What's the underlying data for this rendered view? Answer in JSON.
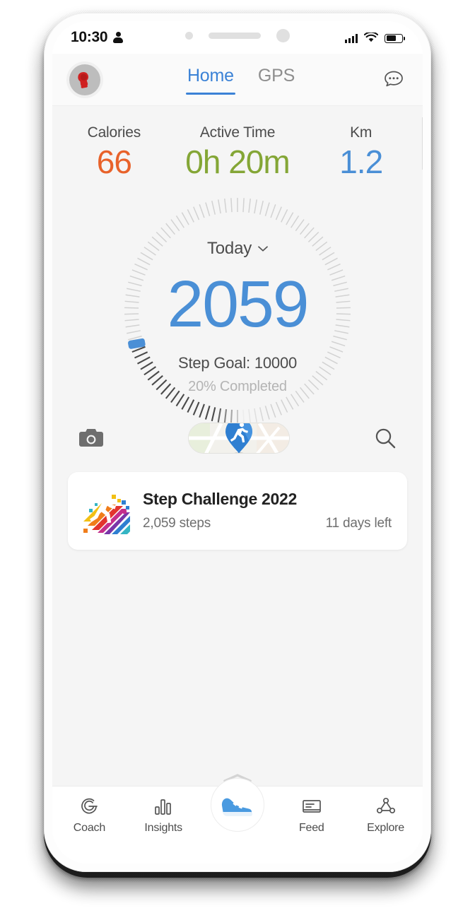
{
  "status_bar": {
    "time": "10:30",
    "person_icon": "person-icon",
    "signal_icon": "signal-bars-icon",
    "wifi_icon": "wifi-icon",
    "battery_icon": "battery-icon"
  },
  "header": {
    "avatar_icon": "avatar-boxing-glove",
    "tabs": [
      {
        "label": "Home",
        "active": true
      },
      {
        "label": "GPS",
        "active": false
      }
    ],
    "chat_icon": "chat-bubble-icon"
  },
  "stats": [
    {
      "label": "Calories",
      "value": "66",
      "color": "#e8622a"
    },
    {
      "label": "Active Time",
      "value": "0h 20m",
      "color": "#84a636"
    },
    {
      "label": "Km",
      "value": "1.2",
      "color": "#4a8fd6"
    }
  ],
  "dial": {
    "period_label": "Today",
    "chevron_icon": "chevron-down-icon",
    "steps": "2059",
    "step_goal_label": "Step Goal: 10000",
    "completed_label": "20% Completed",
    "progress_percent": 20,
    "accent_color": "#4a8fd6",
    "tick_total": 110
  },
  "actions": {
    "camera_icon": "camera-icon",
    "map_toggle_icon": "map-runner-pin-icon",
    "search_icon": "search-icon"
  },
  "challenge": {
    "logo_icon": "rainbow-runner-logo",
    "title": "Step Challenge 2022",
    "steps": "2,059 steps",
    "days_left": "11 days left"
  },
  "drag_handle_icon": "chevron-up-handle-icon",
  "bottom_nav": [
    {
      "label": "Coach",
      "icon": "coach-icon",
      "active": false
    },
    {
      "label": "Insights",
      "icon": "insights-icon",
      "active": false
    },
    {
      "label": "",
      "icon": "shoe-icon",
      "active": true
    },
    {
      "label": "Feed",
      "icon": "feed-icon",
      "active": false
    },
    {
      "label": "Explore",
      "icon": "explore-icon",
      "active": false
    }
  ]
}
